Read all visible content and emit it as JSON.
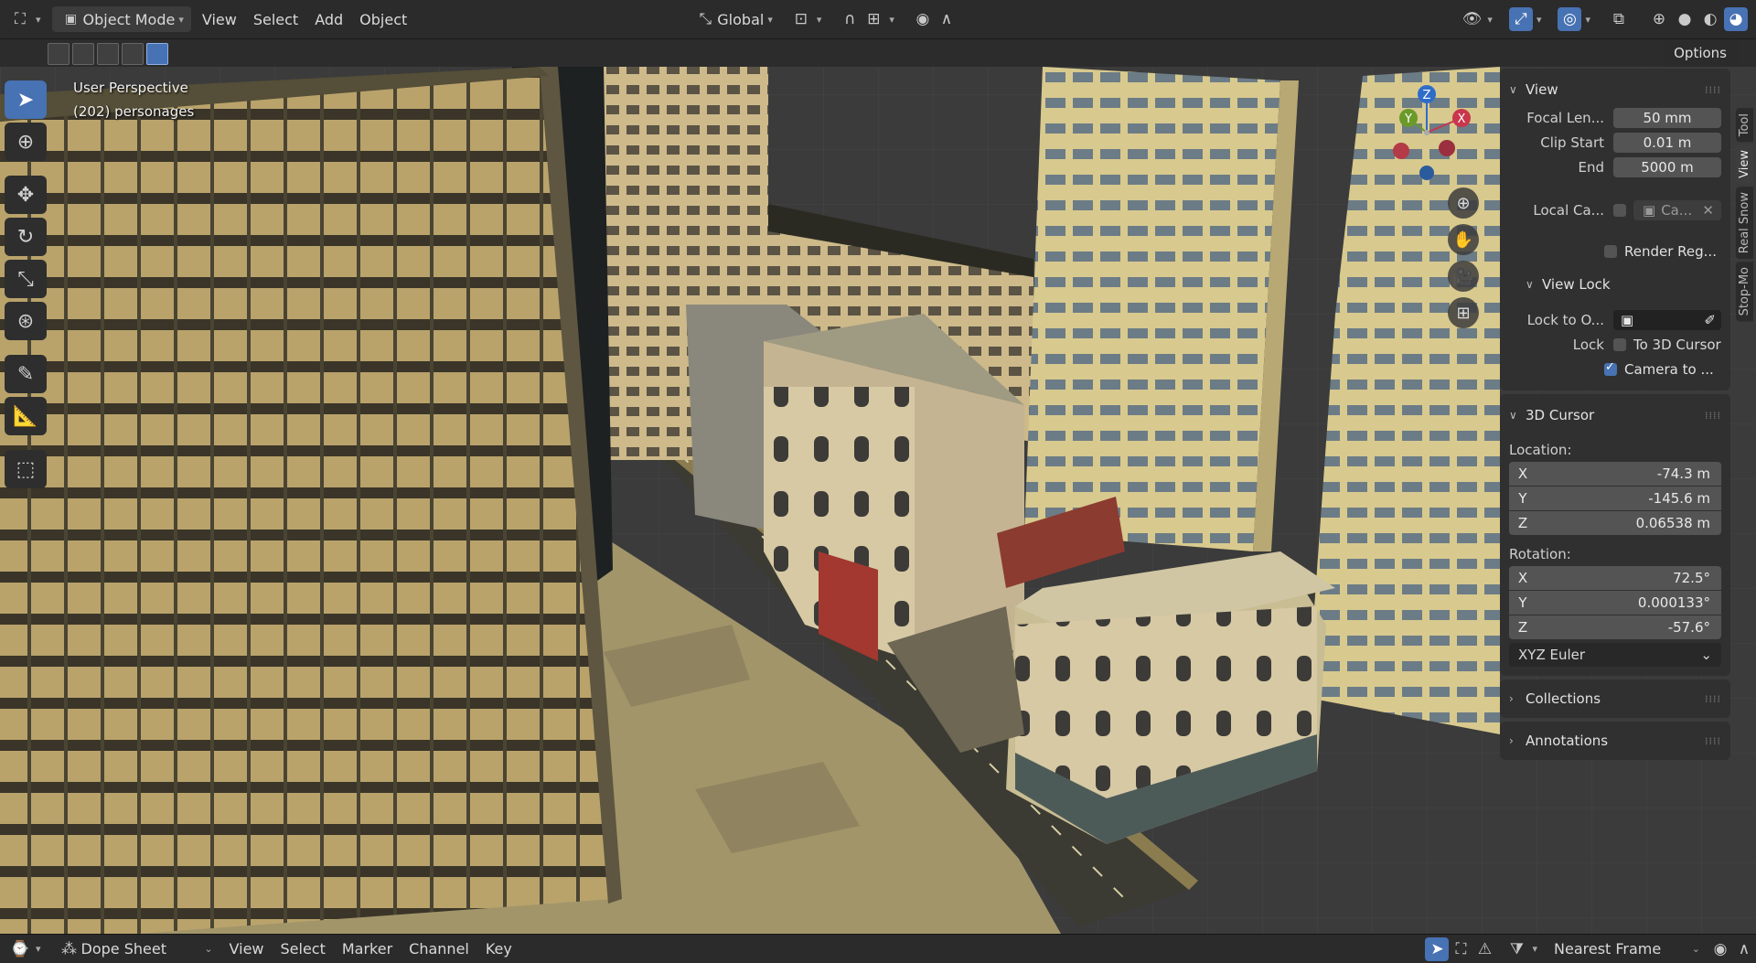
{
  "header": {
    "mode": "Object Mode",
    "menus": [
      "View",
      "Select",
      "Add",
      "Object"
    ],
    "transform_orientation": "Global"
  },
  "viewport": {
    "perspective": "User Perspective",
    "collection_info": "(202) personages",
    "options_label": "Options",
    "gizmo": {
      "z": "Z",
      "y": "Y",
      "x": "X"
    }
  },
  "npanel": {
    "tabs": [
      "Tool",
      "View",
      "Real Snow",
      "Stop-Mo"
    ],
    "view": {
      "title": "View",
      "focal_label": "Focal Len...",
      "focal_value": "50 mm",
      "clip_start_label": "Clip Start",
      "clip_start_value": "0.01 m",
      "end_label": "End",
      "end_value": "5000 m",
      "local_camera_label": "Local Ca...",
      "local_camera_value": "Ca...",
      "render_region_label": "Render Reg...",
      "view_lock_title": "View Lock",
      "lock_to_object_label": "Lock to O...",
      "lock_label": "Lock",
      "to_3d_cursor": "To 3D Cursor",
      "camera_to_view": "Camera to ..."
    },
    "cursor": {
      "title": "3D Cursor",
      "location_label": "Location:",
      "location": [
        {
          "axis": "X",
          "value": "-74.3 m"
        },
        {
          "axis": "Y",
          "value": "-145.6 m"
        },
        {
          "axis": "Z",
          "value": "0.06538 m"
        }
      ],
      "rotation_label": "Rotation:",
      "rotation": [
        {
          "axis": "X",
          "value": "72.5°"
        },
        {
          "axis": "Y",
          "value": "0.000133°"
        },
        {
          "axis": "Z",
          "value": "-57.6°"
        }
      ],
      "rotation_mode": "XYZ Euler"
    },
    "collections_title": "Collections",
    "annotations_title": "Annotations"
  },
  "footer": {
    "editor": "Dope Sheet",
    "menus": [
      "View",
      "Select",
      "Marker",
      "Channel",
      "Key"
    ],
    "snap": "Nearest Frame"
  }
}
